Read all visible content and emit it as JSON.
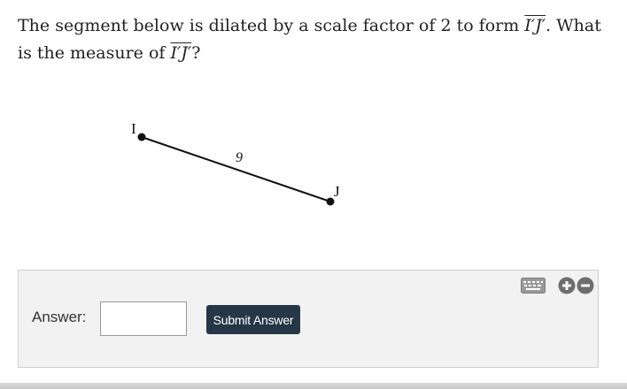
{
  "question": {
    "text_before": "The segment below is dilated by a scale factor of ",
    "scale_factor": "2",
    "text_mid": " to form ",
    "segment_image": "I′J′",
    "text_after": ". What is the measure of ",
    "segment_image_2": "I′J′",
    "text_end": "?"
  },
  "figure": {
    "point_i_label": "I",
    "point_j_label": "J",
    "segment_length": "9"
  },
  "answer_panel": {
    "label": "Answer:",
    "input_value": "",
    "submit_label": "Submit Answer",
    "icons": [
      "keyboard-icon",
      "zoom-in-icon",
      "zoom-out-icon"
    ],
    "button_color": "#253746"
  }
}
